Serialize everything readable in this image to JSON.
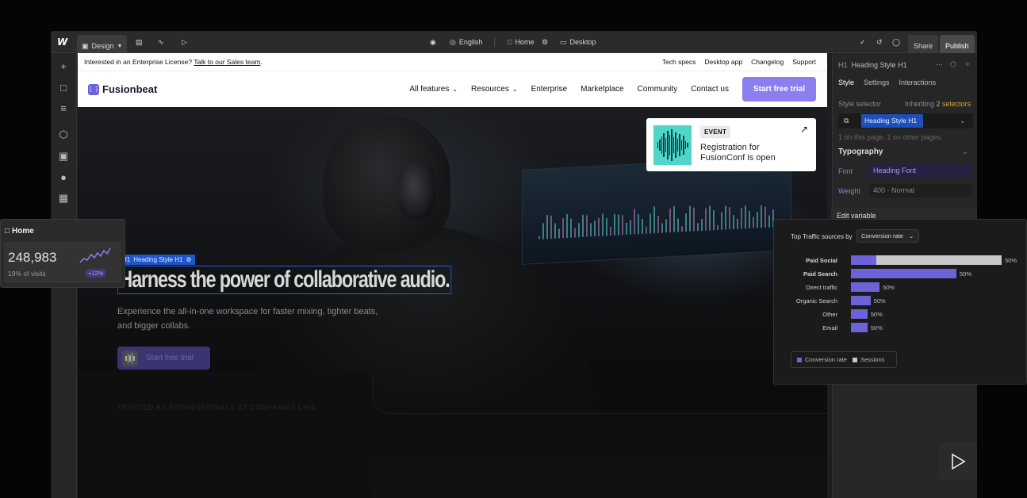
{
  "colors": {
    "accent": "#8b7ff0",
    "selection_blue": "#1c4fb8",
    "bar_primary": "#6c63d9",
    "bar_sessions": "#c8c8c8",
    "event_teal": "#4fd6c9"
  },
  "toolbar": {
    "logo": "W",
    "mode_label": "Design",
    "language": "English",
    "page": "Home",
    "breakpoint": "Desktop",
    "share_label": "Share",
    "publish_label": "Publish"
  },
  "site": {
    "announce_text": "Interested in an Enterprise License?",
    "announce_link": "Talk to our Sales team",
    "announce_end": ".",
    "top_links": [
      "Tech specs",
      "Desktop app",
      "Changelog",
      "Support"
    ],
    "brand": "Fusionbeat",
    "nav": [
      "All features",
      "Resources",
      "Enterprise",
      "Marketplace",
      "Community",
      "Contact us"
    ],
    "cta": "Start free trial",
    "selected_tag": "Heading Style H1",
    "selected_tag_prefix": "H1",
    "headline": "Harness the power of collaborative audio.",
    "subtext": "Experience the all-in-one workspace for faster mixing, tighter beats, and bigger collabs.",
    "hero_cta": "Start free trial",
    "trusted": "TRUSTED BY PROFESSIONALS AT COMPANIES LIKE",
    "event": {
      "badge": "EVENT",
      "title": "Registration for FusionConf is open"
    }
  },
  "style_panel": {
    "element_prefix": "H1",
    "element": "Heading Style H1",
    "tabs": [
      "Style",
      "Settings",
      "Interactions"
    ],
    "selector_label": "Style selector",
    "inheriting": "Inheriting",
    "inheriting_count": "2 selectors",
    "selector_chip": "Heading Style H1",
    "usage": "1 on this page, 1 on other pages.",
    "section": "Typography",
    "font_label": "Font",
    "font_value": "Heading Font",
    "weight_label": "Weight",
    "weight_value": "400 - Normal",
    "edit_variable": "Edit variable"
  },
  "home_stats": {
    "title": "Home",
    "value": "248,983",
    "sub": "19% of visits",
    "badge": "+12%"
  },
  "chart_data": {
    "type": "bar",
    "title": "Top Traffic sources by",
    "metric_dropdown": "Conversion rate",
    "categories": [
      "Paid Social",
      "Paid Search",
      "Direct traffic",
      "Organic Search",
      "Other",
      "Email"
    ],
    "series": [
      {
        "name": "Conversion rate",
        "values": [
          50,
          50,
          50,
          50,
          50,
          50
        ]
      },
      {
        "name": "Sessions",
        "values": [
          100,
          0,
          0,
          0,
          0,
          0
        ]
      }
    ],
    "value_labels": [
      "50%",
      "50%",
      "50%",
      "50%",
      "50%",
      "50%"
    ],
    "bar_fractions": [
      0.17,
      0.7,
      0.19,
      0.13,
      0.11,
      0.11
    ],
    "legend": [
      "Conversion rate",
      "Sessions"
    ]
  }
}
